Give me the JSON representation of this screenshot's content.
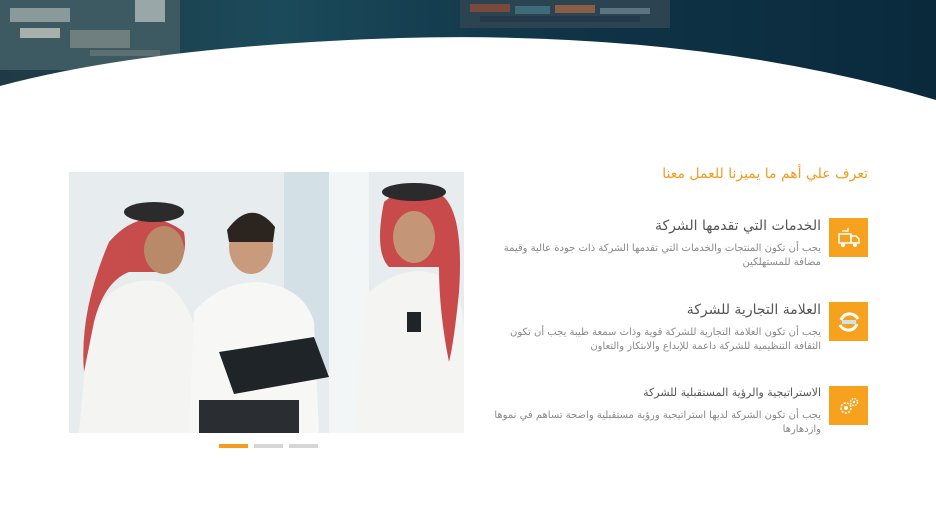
{
  "section": {
    "title": "تعرف علي أهم ما يميزنا للعمل معنا"
  },
  "features": [
    {
      "icon": "delivery-icon",
      "title": "الخدمات التي تقدمها الشركة",
      "desc": "يجب أن تكون المنتجات والخدمات التي تقدمها الشركة ذات جودة عالية وقيمة مضافة للمستهلكين"
    },
    {
      "icon": "exchange-icon",
      "title": "العلامة التجارية للشركة",
      "desc": "يجب أن تكون العلامة التجارية للشركة قوية وذات سمعة طيبة يجب أن تكون الثقافة التنظيمية للشركة داعمة للإبداع والابتكار والتعاون"
    },
    {
      "icon": "gears-icon",
      "title": "الاستراتيجية والرؤية المستقبلية للشركة",
      "desc": "يجب أن تكون الشركة لديها استراتيجية ورؤية مستقبلية واضحة تساهم في نموها وازدهارها"
    }
  ],
  "slider": {
    "image": "business-meeting-photo",
    "slide_count": 3,
    "active_slide": 1
  },
  "colors": {
    "accent": "#f39c1f",
    "icon_bg": "#f7a21f",
    "heading": "#555555",
    "body_text": "#888888",
    "hero": "#1b4a5a"
  }
}
